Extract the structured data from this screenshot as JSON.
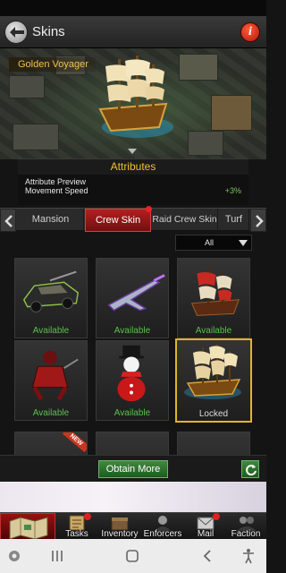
{
  "header": {
    "title": "Skins",
    "info_label": "i"
  },
  "preview": {
    "skin_name": "Golden Voyager"
  },
  "attributes": {
    "title": "Attributes",
    "preview_label": "Attribute Preview",
    "items": [
      {
        "name": "Movement Speed",
        "value": "+3%"
      }
    ]
  },
  "tabs": [
    {
      "label": "Mansion",
      "active": false
    },
    {
      "label": "Crew Skin",
      "active": true,
      "has_notification": true
    },
    {
      "label": "Raid Crew Skin",
      "active": false
    },
    {
      "label": "Turf",
      "active": false
    }
  ],
  "filter": {
    "selected": "All"
  },
  "skins": [
    {
      "item": "armored-car",
      "status": "Available"
    },
    {
      "item": "fighter-jet",
      "status": "Available"
    },
    {
      "item": "red-sail-ship",
      "status": "Available"
    },
    {
      "item": "samurai-armor",
      "status": "Available"
    },
    {
      "item": "snowman",
      "status": "Available"
    },
    {
      "item": "golden-ship",
      "status": "Locked",
      "selected": true
    },
    {
      "item": "new-skin",
      "status": "",
      "badge": "NEW"
    },
    {
      "item": "skin-row3-b",
      "status": ""
    },
    {
      "item": "skin-row3-c",
      "status": ""
    }
  ],
  "actions": {
    "obtain_more": "Obtain More"
  },
  "bottom_nav": [
    {
      "label": "",
      "icon": "map-icon"
    },
    {
      "label": "Tasks",
      "icon": "tasks-icon",
      "badge": true
    },
    {
      "label": "Inventory",
      "icon": "inventory-icon"
    },
    {
      "label": "Enforcers",
      "icon": "enforcers-icon"
    },
    {
      "label": "Mail",
      "icon": "mail-icon",
      "badge": true
    },
    {
      "label": "Faction",
      "icon": "faction-icon"
    }
  ],
  "colors": {
    "accent_red": "#b02020",
    "available_green": "#59c24b",
    "gold": "#f0c030",
    "selection": "#e0b52a"
  }
}
